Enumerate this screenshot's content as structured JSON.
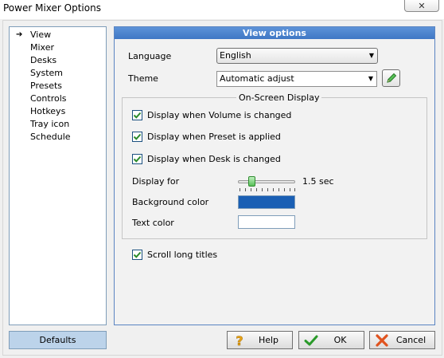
{
  "window": {
    "title": "Power Mixer Options",
    "close_glyph": "✕"
  },
  "sidebar": {
    "items": [
      {
        "label": "View",
        "selected": true
      },
      {
        "label": "Mixer"
      },
      {
        "label": "Desks"
      },
      {
        "label": "System"
      },
      {
        "label": "Presets"
      },
      {
        "label": "Controls"
      },
      {
        "label": "Hotkeys"
      },
      {
        "label": "Tray icon"
      },
      {
        "label": "Schedule"
      }
    ]
  },
  "panel": {
    "header": "View options",
    "language": {
      "label": "Language",
      "value": "English"
    },
    "theme": {
      "label": "Theme",
      "value": "Automatic adjust",
      "edit_icon": "pencil-icon"
    },
    "osd": {
      "title": "On-Screen Display",
      "checks": [
        {
          "label": "Display when Volume is changed",
          "checked": true
        },
        {
          "label": "Display when Preset is applied",
          "checked": true
        },
        {
          "label": "Display when Desk is changed",
          "checked": true
        }
      ],
      "display_for": {
        "label": "Display for",
        "value_text": "1.5 sec",
        "level": 0.2
      },
      "background_color": {
        "label": "Background color",
        "color": "#1a5fb4"
      },
      "text_color": {
        "label": "Text color",
        "color": "#ffffff"
      }
    },
    "scroll_long_titles": {
      "label": "Scroll long titles",
      "checked": true
    }
  },
  "buttons": {
    "defaults": "Defaults",
    "help": "Help",
    "ok": "OK",
    "cancel": "Cancel"
  },
  "colors": {
    "header_blue": "#4a83cc",
    "check_green": "#2a8a2a"
  }
}
